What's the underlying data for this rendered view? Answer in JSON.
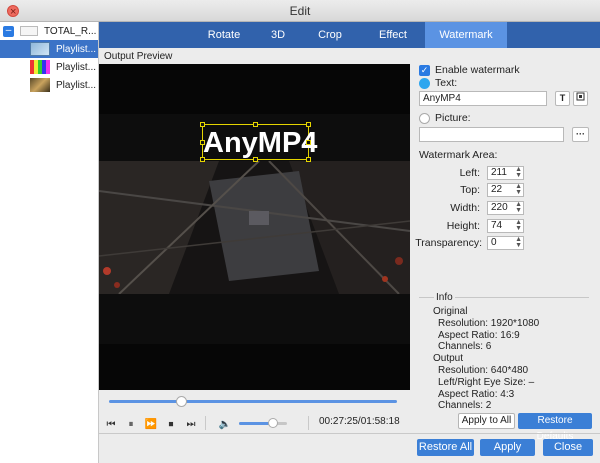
{
  "window": {
    "title": "Edit"
  },
  "sidebar": {
    "root_label": "TOTAL_R...",
    "items": [
      {
        "label": "Playlist..."
      },
      {
        "label": "Playlist..."
      },
      {
        "label": "Playlist..."
      }
    ]
  },
  "tabs": [
    {
      "label": "Rotate"
    },
    {
      "label": "3D"
    },
    {
      "label": "Crop"
    },
    {
      "label": "Effect"
    },
    {
      "label": "Watermark",
      "active": true
    }
  ],
  "preview": {
    "label": "Output Preview",
    "watermark_text": "AnyMP4",
    "time": "00:27:25/01:58:18",
    "seek_progress": 0.25,
    "volume_level": 0.7
  },
  "watermark": {
    "enable_label": "Enable watermark",
    "enable_checked": true,
    "text_label": "Text:",
    "text_value": "AnyMP4",
    "text_selected": true,
    "picture_label": "Picture:",
    "picture_value": "",
    "browse_label": "···",
    "text_format_label": "T",
    "area_label": "Watermark Area:",
    "left_label": "Left:",
    "left_value": "211",
    "top_label": "Top:",
    "top_value": "22",
    "width_label": "Width:",
    "width_value": "220",
    "height_label": "Height:",
    "height_value": "74",
    "transparency_label": "Transparency:",
    "transparency_value": "0"
  },
  "info": {
    "title": "Info",
    "original_label": "Original",
    "orig_resolution": "Resolution: 1920*1080",
    "orig_aspect": "Aspect Ratio: 16:9",
    "orig_channels": "Channels: 6",
    "output_label": "Output",
    "out_resolution": "Resolution: 640*480",
    "out_eye": "Left/Right Eye Size: –",
    "out_aspect": "Aspect Ratio: 4:3",
    "out_channels": "Channels: 2"
  },
  "buttons": {
    "apply_to_all": "Apply to All",
    "restore_defaults": "Restore Defaults",
    "restore_all": "Restore All",
    "apply": "Apply",
    "close": "Close"
  },
  "colors": {
    "tab_bar": "#3162ac",
    "tab_active": "#5b93e3",
    "selection": "#3b73c7",
    "button": "#3b7fd6",
    "watermark_box": "#e4d400"
  }
}
